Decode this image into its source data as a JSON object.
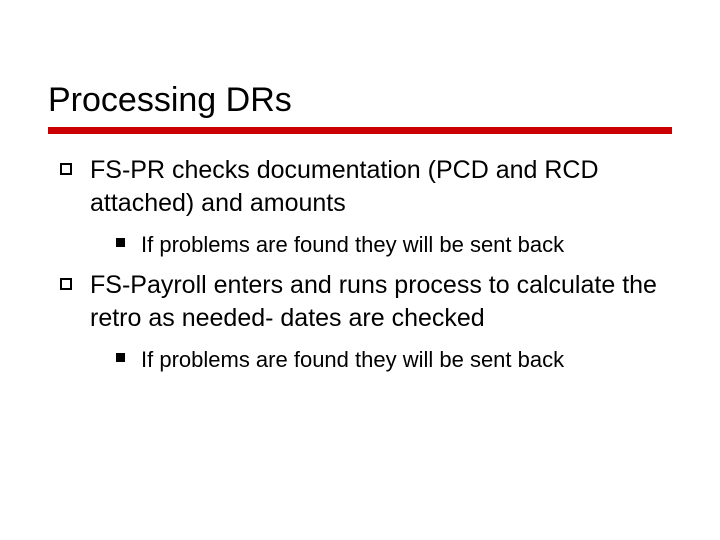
{
  "slide": {
    "title": "Processing DRs",
    "bullets": [
      {
        "level": 1,
        "text": "FS-PR checks documentation (PCD and RCD attached) and amounts",
        "children": [
          {
            "level": 2,
            "text": "If problems are found they will be sent back"
          }
        ]
      },
      {
        "level": 1,
        "text": "FS-Payroll enters and runs process to calculate the retro as needed- dates are checked",
        "children": [
          {
            "level": 2,
            "text": "If problems are found they will be sent back"
          }
        ]
      }
    ]
  },
  "colors": {
    "accent": "#cc0000",
    "text": "#000000",
    "background": "#ffffff"
  }
}
